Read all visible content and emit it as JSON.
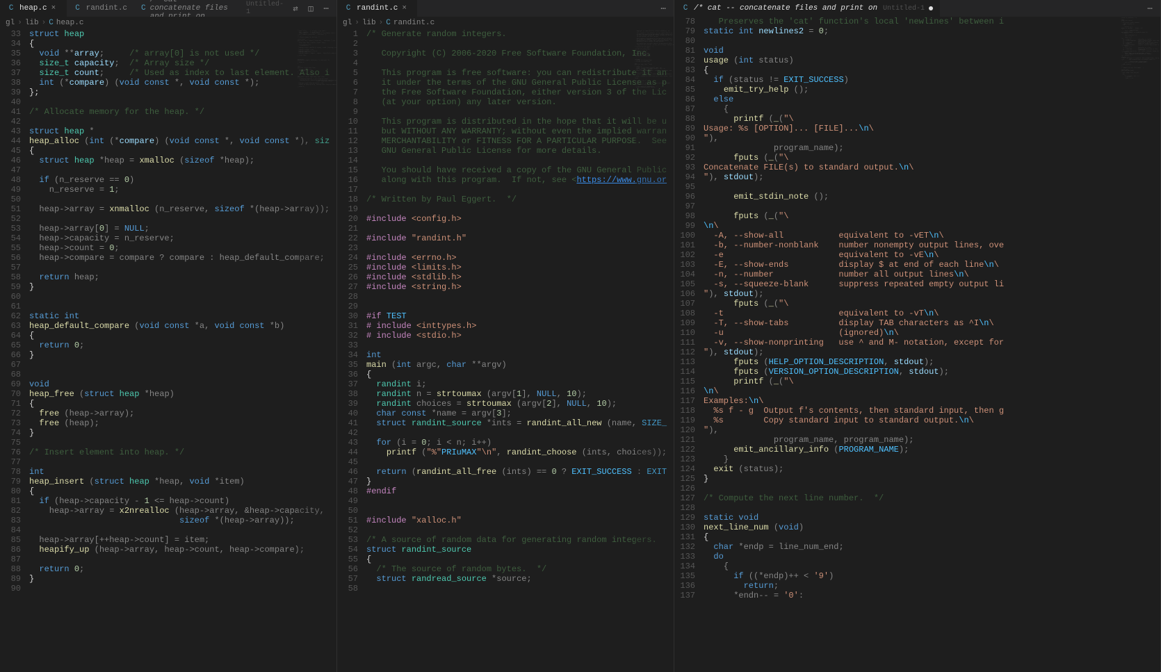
{
  "panes": [
    {
      "tabs": [
        {
          "label": "heap.c",
          "active": true,
          "close": true,
          "lang": "c"
        },
        {
          "label": "randint.c",
          "active": false,
          "close": false,
          "lang": "c"
        },
        {
          "label": "/* cat -- concatenate files and print on",
          "suffix": "Untitled-1",
          "italic": true,
          "lang": "c"
        }
      ],
      "toolbar_icons": [
        "compare-icon",
        "split-icon",
        "more-icon"
      ],
      "breadcrumb": [
        "gl",
        ">",
        "lib",
        ">",
        "C",
        "heap.c"
      ],
      "first_line": 33,
      "lines": [
        "<span class='kw'>struct</span> <span class='type'>heap</span>",
        "<span class='plain'>{</span>",
        "  <span class='kw'>void</span> **<span class='var'>array</span>;     <span class='cmt'>/* array[0] is not used */</span>",
        "  <span class='type'>size_t</span> <span class='var'>capacity</span>;  <span class='cmt'>/* Array size */</span>",
        "  <span class='type'>size_t</span> <span class='var'>count</span>;     <span class='cmt'>/* Used as index to last element. Also i</span>",
        "  <span class='kw'>int</span> (*<span class='var'>compare</span>) (<span class='kw'>void</span> <span class='kw'>const</span> *, <span class='kw'>void</span> <span class='kw'>const</span> *);",
        "<span class='plain'>};</span>",
        "",
        "<span class='cmt'>/* Allocate memory for the heap. */</span>",
        "",
        "<span class='kw'>struct</span> <span class='type'>heap</span> *",
        "<span class='fn'>heap_alloc</span> (<span class='kw'>int</span> (*<span class='var'>compare</span>) (<span class='kw'>void</span> <span class='kw'>const</span> *, <span class='kw'>void</span> <span class='kw'>const</span> *), <span class='type'>siz</span>",
        "<span class='plain'>{</span>",
        "  <span class='kw'>struct</span> <span class='type'>heap</span> *heap = <span class='fn'>xmalloc</span> (<span class='kw'>sizeof</span> *heap);",
        "",
        "  <span class='kw'>if</span> (n_reserve == <span class='num'>0</span>)",
        "    n_reserve = <span class='num'>1</span>;",
        "",
        "  heap-&gt;array = <span class='fn'>xnmalloc</span> (n_reserve, <span class='kw'>sizeof</span> *(heap-&gt;array));",
        "",
        "  heap-&gt;array[<span class='num'>0</span>] = <span class='nul'>NULL</span>;",
        "  heap-&gt;capacity = n_reserve;",
        "  heap-&gt;count = <span class='num'>0</span>;",
        "  heap-&gt;compare = compare ? compare : heap_default_compare;",
        "",
        "  <span class='kw'>return</span> heap;",
        "<span class='plain'>}</span>",
        "",
        "",
        "<span class='kw'>static</span> <span class='kw'>int</span>",
        "<span class='fn'>heap_default_compare</span> (<span class='kw'>void</span> <span class='kw'>const</span> *a, <span class='kw'>void</span> <span class='kw'>const</span> *b)",
        "<span class='plain'>{</span>",
        "  <span class='kw'>return</span> <span class='num'>0</span>;",
        "<span class='plain'>}</span>",
        "",
        "",
        "<span class='kw'>void</span>",
        "<span class='fn'>heap_free</span> (<span class='kw'>struct</span> <span class='type'>heap</span> *heap)",
        "<span class='plain'>{</span>",
        "  <span class='fn'>free</span> (heap-&gt;array);",
        "  <span class='fn'>free</span> (heap);",
        "<span class='plain'>}</span>",
        "",
        "<span class='cmt'>/* Insert element into heap. */</span>",
        "",
        "<span class='kw'>int</span>",
        "<span class='fn'>heap_insert</span> (<span class='kw'>struct</span> <span class='type'>heap</span> *heap, <span class='kw'>void</span> *item)",
        "<span class='plain'>{</span>",
        "  <span class='kw'>if</span> (heap-&gt;capacity - <span class='num'>1</span> &lt;= heap-&gt;count)",
        "    heap-&gt;array = <span class='fn'>x2nrealloc</span> (heap-&gt;array, &amp;heap-&gt;capacity,",
        "                              <span class='kw'>sizeof</span> *(heap-&gt;array));",
        "",
        "  heap-&gt;array[++heap-&gt;count] = item;",
        "  <span class='fn'>heapify_up</span> (heap-&gt;array, heap-&gt;count, heap-&gt;compare);",
        "",
        "  <span class='kw'>return</span> <span class='num'>0</span>;",
        "<span class='plain'>}</span>",
        ""
      ]
    },
    {
      "tabs": [
        {
          "label": "randint.c",
          "active": true,
          "close": true,
          "lang": "c"
        }
      ],
      "toolbar_icons": [
        "more-icon"
      ],
      "breadcrumb": [
        "gl",
        ">",
        "lib",
        ">",
        "C",
        "randint.c"
      ],
      "first_line": 1,
      "lines": [
        "<span class='cmt'>/* Generate random integers.</span>",
        "",
        "<span class='cmt'>   Copyright (C) 2006-2020 Free Software Foundation, Inc.</span>",
        "",
        "<span class='cmt'>   This program is free software: you can redistribute it an</span>",
        "<span class='cmt'>   it under the terms of the GNU General Public License as p</span>",
        "<span class='cmt'>   the Free Software Foundation, either version 3 of the Lic</span>",
        "<span class='cmt'>   (at your option) any later version.</span>",
        "",
        "<span class='cmt'>   This program is distributed in the hope that it will be u</span>",
        "<span class='cmt'>   but WITHOUT ANY WARRANTY; without even the implied warran</span>",
        "<span class='cmt'>   MERCHANTABILITY or FITNESS FOR A PARTICULAR PURPOSE.  See </span>",
        "<span class='cmt'>   GNU General Public License for more details.</span>",
        "",
        "<span class='cmt'>   You should have received a copy of the GNU General Public</span>",
        "<span class='cmt'>   along with this program.  If not, see &lt;</span><span style='color:#3b8eea;text-decoration:underline'>https://www.gnu.or</span>",
        "",
        "<span class='cmt'>/* Written by Paul Eggert.  */</span>",
        "",
        "<span class='pp'>#include</span> <span class='str'>&lt;config.h&gt;</span>",
        "",
        "<span class='pp'>#include</span> <span class='str'>\"randint.h\"</span>",
        "",
        "<span class='pp'>#include</span> <span class='str'>&lt;errno.h&gt;</span>",
        "<span class='pp'>#include</span> <span class='str'>&lt;limits.h&gt;</span>",
        "<span class='pp'>#include</span> <span class='str'>&lt;stdlib.h&gt;</span>",
        "<span class='pp'>#include</span> <span class='str'>&lt;string.h&gt;</span>",
        "",
        "",
        "<span class='pp'>#if</span> <span class='macro'>TEST</span>",
        "<span class='pp'># include</span> <span class='str'>&lt;inttypes.h&gt;</span>",
        "<span class='pp'># include</span> <span class='str'>&lt;stdio.h&gt;</span>",
        "",
        "<span class='kw'>int</span>",
        "<span class='fn'>main</span> (<span class='kw'>int</span> argc, <span class='kw'>char</span> **argv)",
        "<span class='plain'>{</span>",
        "  <span class='type'>randint</span> i;",
        "  <span class='type'>randint</span> n = <span class='fn'>strtoumax</span> (argv[<span class='num'>1</span>], <span class='nul'>NULL</span>, <span class='num'>10</span>);",
        "  <span class='type'>randint</span> choices = <span class='fn'>strtoumax</span> (argv[<span class='num'>2</span>], <span class='nul'>NULL</span>, <span class='num'>10</span>);",
        "  <span class='kw'>char</span> <span class='kw'>const</span> *name = argv[<span class='num'>3</span>];",
        "  <span class='kw'>struct</span> <span class='type'>randint_source</span> *ints = <span class='fn'>randint_all_new</span> (name, <span class='macro'>SIZE_</span>",
        "",
        "  <span class='kw'>for</span> (i = <span class='num'>0</span>; i &lt; n; i++)",
        "    <span class='fn'>printf</span> (<span class='str'>\"%\"</span><span class='macro'>PRIuMAX</span><span class='str'>\"\\n\"</span>, <span class='fn'>randint_choose</span> (ints, choices));",
        "",
        "  <span class='kw'>return</span> (<span class='fn'>randint_all_free</span> (ints) == <span class='num'>0</span> ? <span class='macro'>EXIT_SUCCESS</span> : <span class='macro'>EXIT</span>",
        "<span class='plain'>}</span>",
        "<span class='pp'>#endif</span>",
        "",
        "",
        "<span class='pp'>#include</span> <span class='str'>\"xalloc.h\"</span>",
        "",
        "<span class='cmt'>/* A source of random data for generating random integers.</span>",
        "<span class='kw'>struct</span> <span class='type'>randint_source</span>",
        "<span class='plain'>{</span>",
        "  <span class='cmt'>/* The source of random bytes.  */</span>",
        "  <span class='kw'>struct</span> <span class='type'>randread_source</span> *source;",
        ""
      ]
    },
    {
      "tabs": [
        {
          "label": "/* cat -- concatenate files and print on",
          "suffix": "Untitled-1",
          "italic": true,
          "active": true,
          "modified": true,
          "lang": "c"
        }
      ],
      "toolbar_icons": [
        "more-icon"
      ],
      "breadcrumb": [],
      "first_line": 78,
      "lines": [
        "   <span class='cmt'>Preserves the 'cat' function's local 'newlines' between i</span>",
        "<span class='kw'>static</span> <span class='kw'>int</span> <span class='var'>newlines2</span> = <span class='num'>0</span>;",
        "",
        "<span class='kw'>void</span>",
        "<span class='fn'>usage</span> (<span class='kw'>int</span> status)",
        "<span class='plain'>{</span>",
        "  <span class='kw'>if</span> (status != <span class='macro'>EXIT_SUCCESS</span>)",
        "    <span class='fn'>emit_try_help</span> ();",
        "  <span class='kw'>else</span>",
        "    {",
        "      <span class='fn'>printf</span> (<span class='fn'>_</span>(<span class='str'>\"\\</span>",
        "<span class='str'>Usage: %s [OPTION]... [FILE]...</span><span class='macro'>\\n</span><span class='str'>\\</span>",
        "<span class='str'>\"</span>),",
        "              program_name);",
        "      <span class='fn'>fputs</span> (<span class='fn'>_</span>(<span class='str'>\"\\</span>",
        "<span class='str'>Concatenate FILE(s) to standard output.</span><span class='macro'>\\n</span><span class='str'>\\</span>",
        "<span class='str'>\"</span>), <span class='var'>stdout</span>);",
        "",
        "      <span class='fn'>emit_stdin_note</span> ();",
        "",
        "      <span class='fn'>fputs</span> (<span class='fn'>_</span>(<span class='str'>\"\\</span>",
        "<span class='macro'>\\n</span><span class='str'>\\</span>",
        "<span class='str'>  -A, --show-all           equivalent to -vET</span><span class='macro'>\\n</span><span class='str'>\\</span>",
        "<span class='str'>  -b, --number-nonblank    number nonempty output lines, ove</span>",
        "<span class='str'>  -e                       equivalent to -vE</span><span class='macro'>\\n</span><span class='str'>\\</span>",
        "<span class='str'>  -E, --show-ends          display $ at end of each line</span><span class='macro'>\\n</span><span class='str'>\\</span>",
        "<span class='str'>  -n, --number             number all output lines</span><span class='macro'>\\n</span><span class='str'>\\</span>",
        "<span class='str'>  -s, --squeeze-blank      suppress repeated empty output li</span>",
        "<span class='str'>\"</span>), <span class='var'>stdout</span>);",
        "      <span class='fn'>fputs</span> (<span class='fn'>_</span>(<span class='str'>\"\\</span>",
        "<span class='str'>  -t                       equivalent to -vT</span><span class='macro'>\\n</span><span class='str'>\\</span>",
        "<span class='str'>  -T, --show-tabs          display TAB characters as ^I</span><span class='macro'>\\n</span><span class='str'>\\</span>",
        "<span class='str'>  -u                       (ignored)</span><span class='macro'>\\n</span><span class='str'>\\</span>",
        "<span class='str'>  -v, --show-nonprinting   use ^ and M- notation, except for</span>",
        "<span class='str'>\"</span>), <span class='var'>stdout</span>);",
        "      <span class='fn'>fputs</span> (<span class='macro'>HELP_OPTION_DESCRIPTION</span>, <span class='var'>stdout</span>);",
        "      <span class='fn'>fputs</span> (<span class='macro'>VERSION_OPTION_DESCRIPTION</span>, <span class='var'>stdout</span>);",
        "      <span class='fn'>printf</span> (<span class='fn'>_</span>(<span class='str'>\"\\</span>",
        "<span class='macro'>\\n</span><span class='str'>\\</span>",
        "<span class='str'>Examples:</span><span class='macro'>\\n</span><span class='str'>\\</span>",
        "<span class='str'>  %s f - g  Output f's contents, then standard input, then g</span>",
        "<span class='str'>  %s        Copy standard input to standard output.</span><span class='macro'>\\n</span><span class='str'>\\</span>",
        "<span class='str'>\"</span>),",
        "              program_name, program_name);",
        "      <span class='fn'>emit_ancillary_info</span> (<span class='macro'>PROGRAM_NAME</span>);",
        "    }",
        "  <span class='fn'>exit</span> (status);",
        "<span class='plain'>}</span>",
        "",
        "<span class='cmt'>/* Compute the next line number.  */</span>",
        "",
        "<span class='kw'>static</span> <span class='kw'>void</span>",
        "<span class='fn'>next_line_num</span> (<span class='kw'>void</span>)",
        "<span class='plain'>{</span>",
        "  <span class='kw'>char</span> *endp = line_num_end;",
        "  <span class='kw'>do</span>",
        "    {",
        "      <span class='kw'>if</span> ((*endp)++ &lt; <span class='str'>'9'</span>)",
        "        <span class='kw'>return</span>;",
        "      *endn-- = <span class='str'>'0'</span>:"
      ]
    }
  ]
}
